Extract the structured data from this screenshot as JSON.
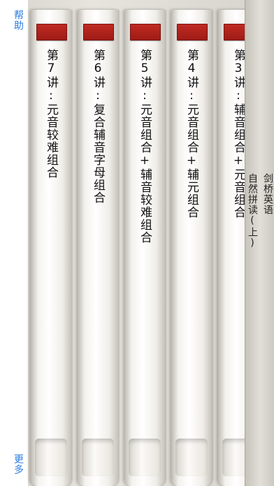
{
  "nav": {
    "help_label": "帮助",
    "more_label": "更多"
  },
  "cover": {
    "line1": "剑桥英语",
    "line2": "自然拼读(上)"
  },
  "books": [
    {
      "title": "第7讲:元音较难组合"
    },
    {
      "title": "第6讲:复合辅音字母组合"
    },
    {
      "title": "第5讲:元音组合+辅音较难组合"
    },
    {
      "title": "第4讲:元音组合+辅元组合"
    },
    {
      "title": "第3讲:辅音组合+元音组合"
    }
  ],
  "colors": {
    "link": "#2a7be0",
    "tab_red": "#b0241d"
  }
}
